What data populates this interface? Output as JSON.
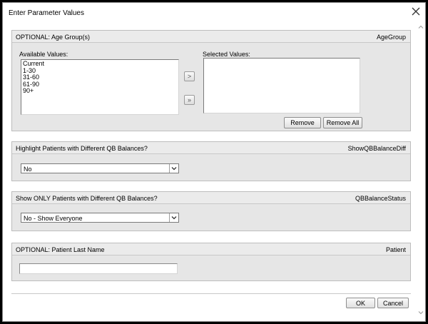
{
  "dialog": {
    "title": "Enter Parameter Values"
  },
  "age_group": {
    "label": "OPTIONAL: Age Group(s)",
    "param": "AgeGroup",
    "available_label": "Available Values:",
    "selected_label": "Selected Values:",
    "available": [
      "Current",
      "1-30",
      "31-60",
      "61-90",
      "90+"
    ],
    "selected": [],
    "add_symbol": ">",
    "add_all_symbol": "»",
    "remove_label": "Remove",
    "remove_all_label": "Remove All"
  },
  "highlight": {
    "label": "Highlight Patients with Different QB Balances?",
    "param": "ShowQBBalanceDiff",
    "value": "No"
  },
  "show_only": {
    "label": "Show ONLY Patients with Different QB Balances?",
    "param": "QBBalanceStatus",
    "value": "No - Show Everyone"
  },
  "last_name": {
    "label": "OPTIONAL: Patient Last Name",
    "param": "Patient",
    "value": ""
  },
  "footer": {
    "ok_label": "OK",
    "cancel_label": "Cancel"
  }
}
